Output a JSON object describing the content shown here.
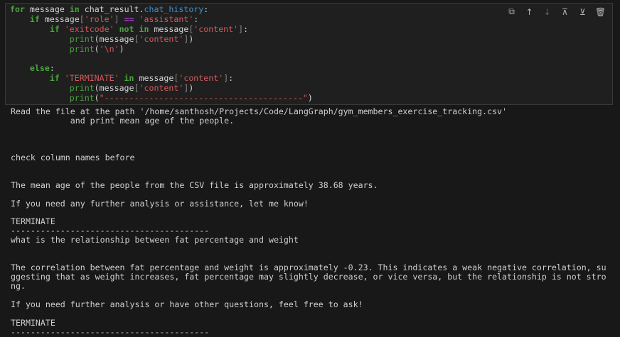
{
  "code": {
    "lines": [
      [
        [
          "kw",
          "for"
        ],
        [
          "",
          "  message "
        ],
        [
          "kw",
          "in"
        ],
        [
          "",
          "  chat_result."
        ],
        [
          "attr",
          "chat_history"
        ],
        [
          "",
          ":"
        ]
      ],
      [
        [
          "",
          "    "
        ],
        [
          "kw",
          "if"
        ],
        [
          "",
          "  message"
        ],
        [
          "br",
          "["
        ],
        [
          "str",
          "'role'"
        ],
        [
          "br",
          "]"
        ],
        [
          "",
          ""
        ],
        [
          "op",
          " == "
        ],
        [
          "str",
          "'assistant'"
        ],
        [
          "",
          ":"
        ]
      ],
      [
        [
          "",
          "        "
        ],
        [
          "kw",
          "if"
        ],
        [
          "str",
          " 'exitcode'"
        ],
        [
          "kw",
          " not in"
        ],
        [
          "",
          "  message"
        ],
        [
          "br",
          "["
        ],
        [
          "str",
          "'content'"
        ],
        [
          "br",
          "]"
        ],
        [
          "",
          ":"
        ]
      ],
      [
        [
          "",
          "            "
        ],
        [
          "bi",
          "print"
        ],
        [
          "",
          "(message"
        ],
        [
          "br",
          "["
        ],
        [
          "str",
          "'content'"
        ],
        [
          "br",
          "]"
        ],
        [
          "",
          ")"
        ]
      ],
      [
        [
          "",
          "            "
        ],
        [
          "bi",
          "print"
        ],
        [
          "",
          "("
        ],
        [
          "str",
          "'\\n'"
        ],
        [
          "",
          ")"
        ]
      ],
      [
        [
          "",
          ""
        ]
      ],
      [
        [
          "",
          "    "
        ],
        [
          "kw",
          "else"
        ],
        [
          "",
          ":"
        ]
      ],
      [
        [
          "",
          "        "
        ],
        [
          "kw",
          "if"
        ],
        [
          "str",
          " 'TERMINATE'"
        ],
        [
          "kw",
          " in"
        ],
        [
          "",
          "  message"
        ],
        [
          "br",
          "["
        ],
        [
          "str",
          "'content'"
        ],
        [
          "br",
          "]"
        ],
        [
          "",
          ":"
        ]
      ],
      [
        [
          "",
          "            "
        ],
        [
          "bi",
          "print"
        ],
        [
          "",
          "(message"
        ],
        [
          "br",
          "["
        ],
        [
          "str",
          "'content'"
        ],
        [
          "br",
          "]"
        ],
        [
          "",
          ")"
        ]
      ],
      [
        [
          "",
          "            "
        ],
        [
          "bi",
          "print"
        ],
        [
          "",
          "("
        ],
        [
          "str",
          "\"----------------------------------------\""
        ],
        [
          "",
          ")"
        ]
      ]
    ]
  },
  "toolbar": {
    "copy": "⧉",
    "up": "↑",
    "down": "↓",
    "insert_above": "⊼",
    "insert_below": "⊻",
    "delete": "🗑"
  },
  "output": "Read the file at the path '/home/santhosh/Projects/Code/LangGraph/gym_members_exercise_tracking.csv'\n            and print mean age of the people.\n\n\n\ncheck column names before\n\n\nThe mean age of the people from the CSV file is approximately 38.68 years.\n\nIf you need any further analysis or assistance, let me know!\n\nTERMINATE\n----------------------------------------\nwhat is the relationship between fat percentage and weight\n\n\nThe correlation between fat percentage and weight is approximately -0.23. This indicates a weak negative correlation, su\nggesting that as weight increases, fat percentage may slightly decrease, or vice versa, but the relationship is not stro\nng.\n\nIf you need further analysis or have other questions, feel free to ask!\n\nTERMINATE\n----------------------------------------"
}
